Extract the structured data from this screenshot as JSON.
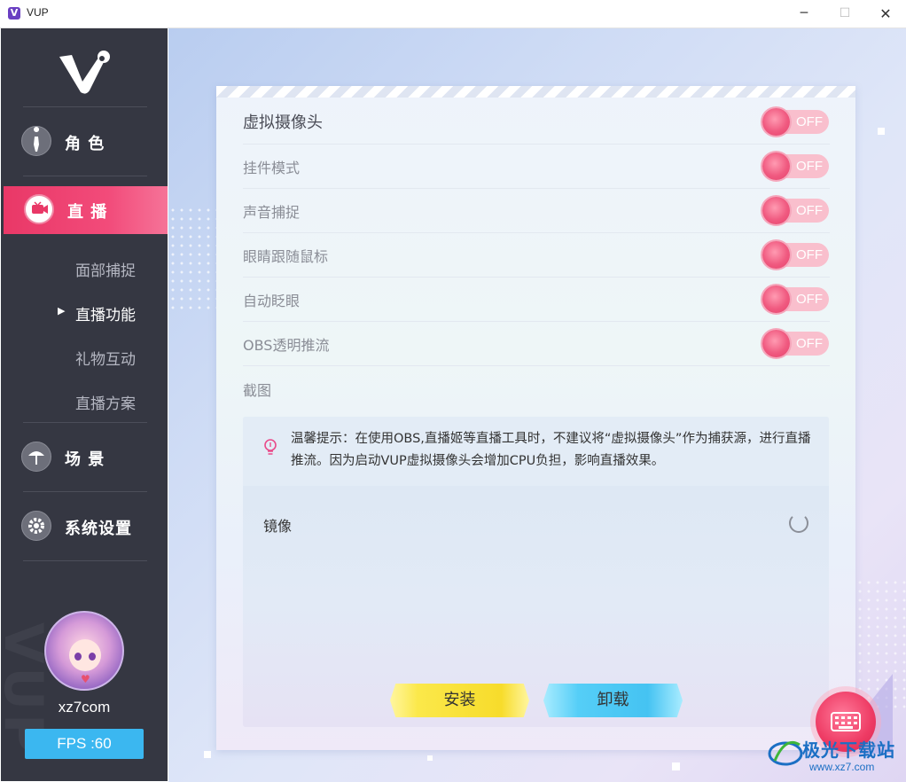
{
  "window": {
    "title": "VUP",
    "logo_letter": "V"
  },
  "sidebar": {
    "nav": [
      {
        "label": "角 色",
        "icon": "character-icon"
      },
      {
        "label": "直 播",
        "icon": "live-camera-icon",
        "active": true
      },
      {
        "label": "场 景",
        "icon": "scene-umbrella-icon"
      },
      {
        "label": "系统设置",
        "icon": "gear-icon"
      }
    ],
    "sub": [
      {
        "label": "面部捕捉"
      },
      {
        "label": "直播功能",
        "current": true
      },
      {
        "label": "礼物互动"
      },
      {
        "label": "直播方案"
      }
    ],
    "username": "xz7com",
    "fps": "FPS :60",
    "watermark": "VUP"
  },
  "panel": {
    "rows": [
      {
        "label": "虚拟摄像头",
        "toggle": "OFF"
      },
      {
        "label": "挂件模式",
        "toggle": "OFF"
      },
      {
        "label": "声音捕捉",
        "toggle": "OFF"
      },
      {
        "label": "眼睛跟随鼠标",
        "toggle": "OFF"
      },
      {
        "label": "自动眨眼",
        "toggle": "OFF"
      },
      {
        "label": "OBS透明推流",
        "toggle": "OFF"
      }
    ],
    "screenshot_label": "截图",
    "tip": "温馨提示：在使用OBS,直播姬等直播工具时，不建议将“虚拟摄像头”作为捕获源，进行直播推流。因为启动VUP虚拟摄像头会增加CPU负担，影响直播效果。",
    "mirror_label": "镜像",
    "install_label": "安装",
    "uninstall_label": "卸载"
  },
  "colors": {
    "accent": "#e93867",
    "sidebar_bg": "#353742",
    "fps_bg": "#3bb7f0"
  },
  "watermark": {
    "site_name": "极光下载站",
    "site_url": "www.xz7.com"
  }
}
